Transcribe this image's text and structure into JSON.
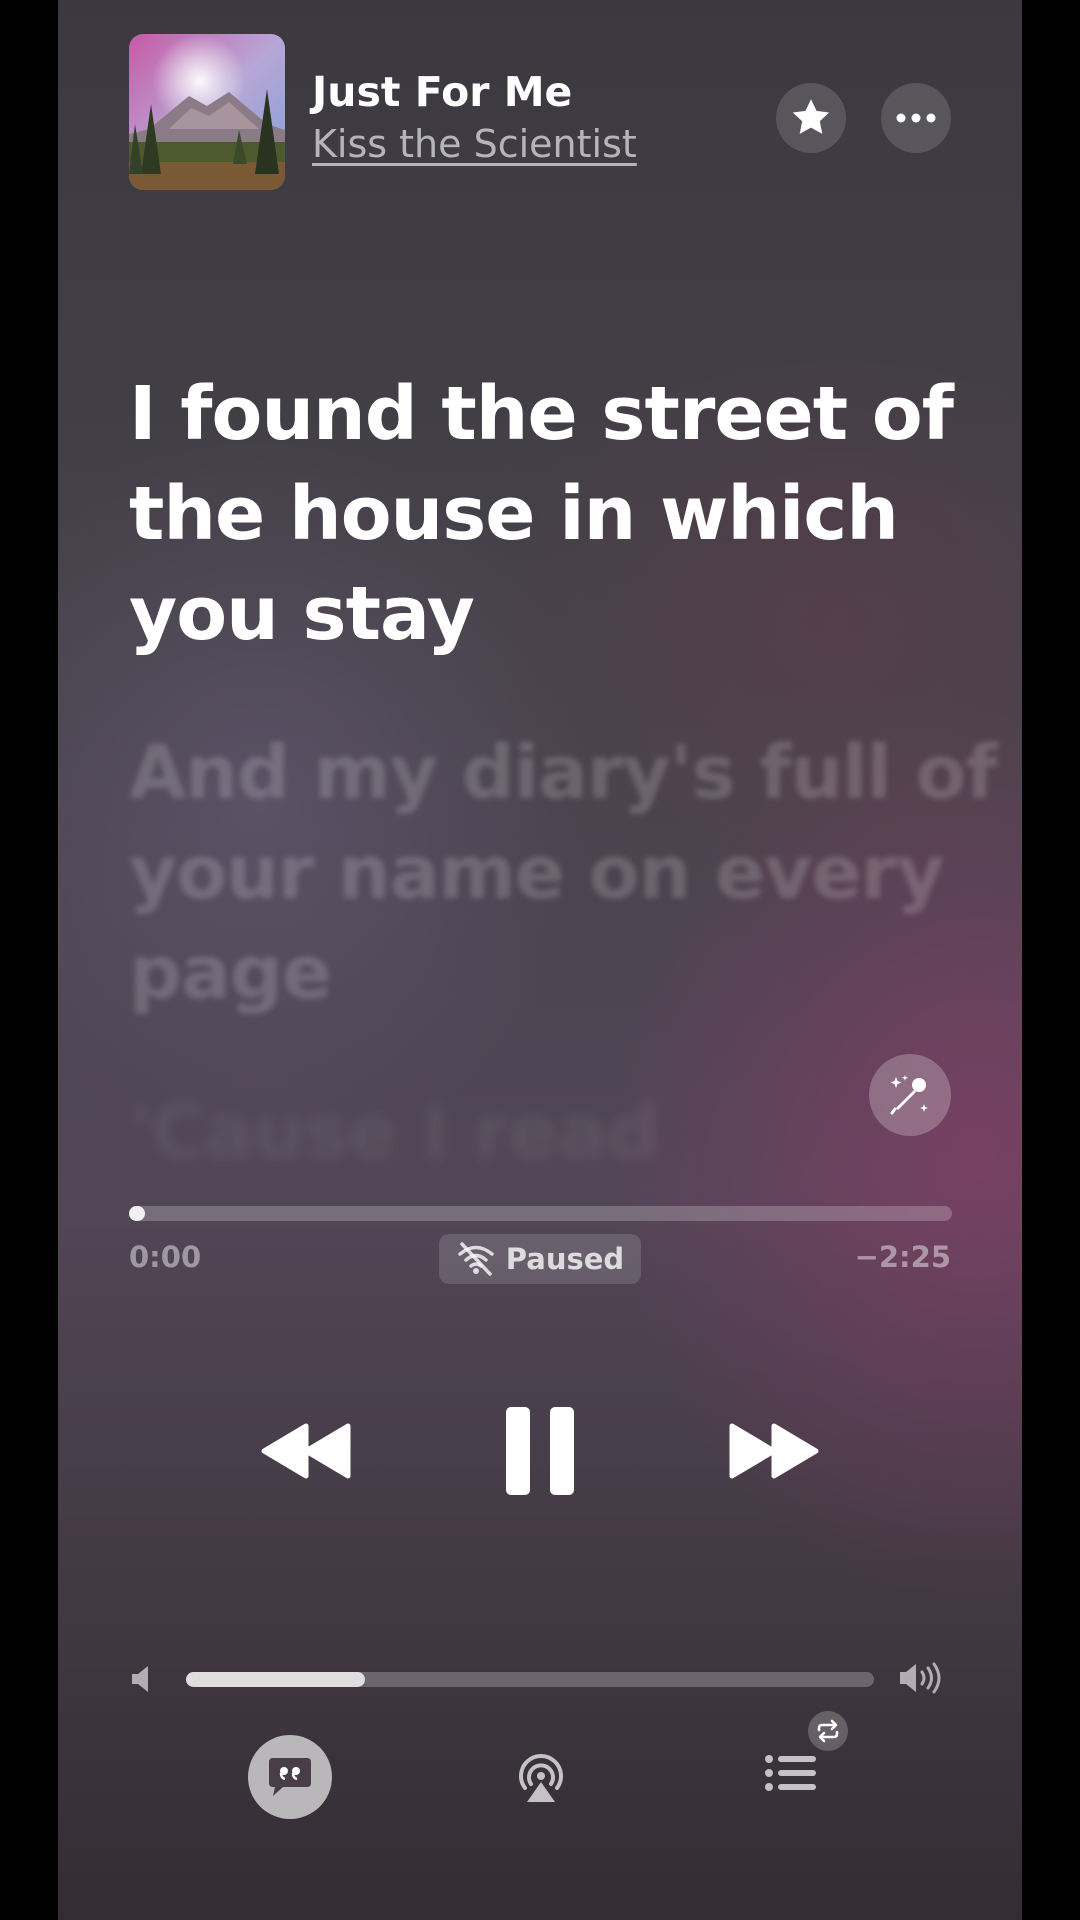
{
  "header": {
    "song_title": "Just For Me",
    "artist": "Kiss the Scientist",
    "artwork_icon": "album-artwork-mountain",
    "favorite_icon": "star-icon",
    "more_icon": "ellipsis-icon"
  },
  "lyrics": {
    "current": "I found the street of the house in which you stay",
    "next": "And my diary's full of your name on every page",
    "after": "'Cause I read"
  },
  "sing_icon": "microphone-sparkle-icon",
  "playback": {
    "elapsed": "0:00",
    "remaining": "−2:25",
    "status": "Paused",
    "status_icon": "wifi-slash-icon",
    "progress_fraction": 0.0
  },
  "controls": {
    "rewind_icon": "backward-icon",
    "pause_icon": "pause-icon",
    "forward_icon": "forward-icon"
  },
  "volume": {
    "level_fraction": 0.26,
    "low_icon": "speaker-low-icon",
    "high_icon": "speaker-high-icon"
  },
  "bottom_bar": {
    "lyrics_icon": "quote-bubble-icon",
    "airplay_icon": "airplay-icon",
    "queue_icon": "list-icon",
    "repeat_icon": "repeat-icon"
  },
  "colors": {
    "text_primary": "#ffffff",
    "background_top": "#3b393f",
    "background_accent": "#963c6e"
  }
}
